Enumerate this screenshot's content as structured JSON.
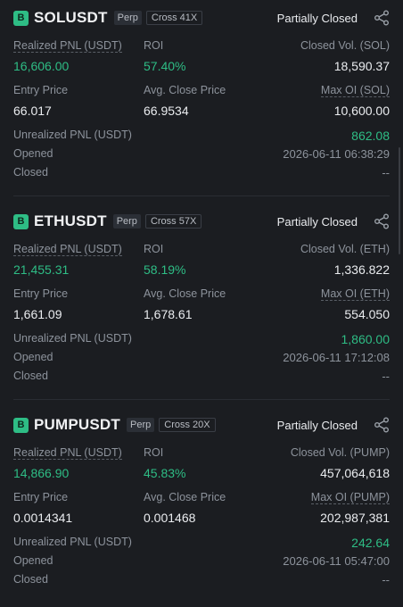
{
  "labels": {
    "realized_pnl": "Realized PNL (USDT)",
    "roi": "ROI",
    "entry_price": "Entry Price",
    "avg_close_price": "Avg. Close Price",
    "unrealized_pnl": "Unrealized PNL (USDT)",
    "opened": "Opened",
    "closed": "Closed"
  },
  "colors": {
    "accent_green": "#2ebd85",
    "background": "#1b1d21"
  },
  "positions": [
    {
      "badge": "B",
      "symbol": "SOLUSDT",
      "type_tag": "Perp",
      "margin_tag": "Cross 41X",
      "status": "Partially Closed",
      "realized_pnl": "16,606.00",
      "roi": "57.40%",
      "closed_vol_label": "Closed Vol. (SOL)",
      "closed_vol": "18,590.37",
      "entry_price": "66.017",
      "avg_close_price": "66.9534",
      "max_oi_label": "Max OI (SOL)",
      "max_oi": "10,600.00",
      "unrealized_pnl": "862.08",
      "opened": "2026-06-11 06:38:29",
      "closed": "--"
    },
    {
      "badge": "B",
      "symbol": "ETHUSDT",
      "type_tag": "Perp",
      "margin_tag": "Cross 57X",
      "status": "Partially Closed",
      "realized_pnl": "21,455.31",
      "roi": "58.19%",
      "closed_vol_label": "Closed Vol. (ETH)",
      "closed_vol": "1,336.822",
      "entry_price": "1,661.09",
      "avg_close_price": "1,678.61",
      "max_oi_label": "Max OI (ETH)",
      "max_oi": "554.050",
      "unrealized_pnl": "1,860.00",
      "opened": "2026-06-11 17:12:08",
      "closed": "--"
    },
    {
      "badge": "B",
      "symbol": "PUMPUSDT",
      "type_tag": "Perp",
      "margin_tag": "Cross 20X",
      "status": "Partially Closed",
      "realized_pnl": "14,866.90",
      "roi": "45.83%",
      "closed_vol_label": "Closed Vol. (PUMP)",
      "closed_vol": "457,064,618",
      "entry_price": "0.0014341",
      "avg_close_price": "0.001468",
      "max_oi_label": "Max OI (PUMP)",
      "max_oi": "202,987,381",
      "unrealized_pnl": "242.64",
      "opened": "2026-06-11 05:47:00",
      "closed": "--"
    }
  ]
}
